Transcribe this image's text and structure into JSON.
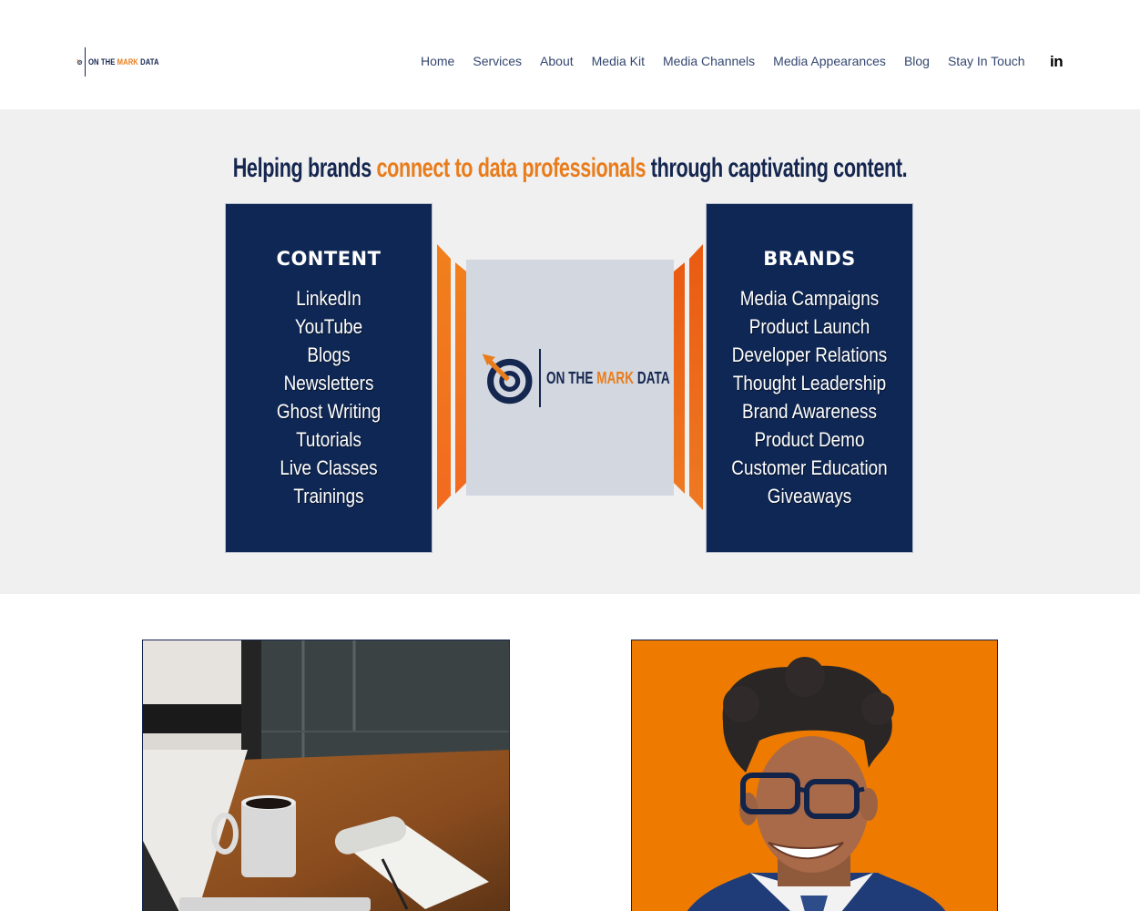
{
  "brand": {
    "logo_text_prefix": "ON THE ",
    "logo_text_accent": "MARK",
    "logo_text_suffix": " DATA",
    "primary_color": "#15264f",
    "accent_color": "#e97c1b"
  },
  "nav": {
    "items": [
      {
        "label": "Home"
      },
      {
        "label": "Services"
      },
      {
        "label": "About"
      },
      {
        "label": "Media Kit"
      },
      {
        "label": "Media Channels"
      },
      {
        "label": "Media Appearances"
      },
      {
        "label": "Blog"
      },
      {
        "label": "Stay In Touch"
      }
    ],
    "social_icon": "linkedin-icon",
    "social_label": "in"
  },
  "hero": {
    "tagline_start": "Helping brands ",
    "tagline_accent": "connect to data professionals",
    "tagline_end": " through captivating content.",
    "content_panel": {
      "title": "CONTENT",
      "items": [
        "LinkedIn",
        "YouTube",
        "Blogs",
        "Newsletters",
        "Ghost Writing",
        "Tutorials",
        "Live Classes",
        "Trainings"
      ]
    },
    "brands_panel": {
      "title": "BRANDS",
      "items": [
        "Media Campaigns",
        "Product Launch",
        "Developer Relations",
        "Thought Leadership",
        "Brand Awareness",
        "Product Demo",
        "Customer Education",
        "Giveaways"
      ]
    }
  },
  "images": {
    "left": "coffee-desk-photo",
    "right": "portrait-photo"
  }
}
